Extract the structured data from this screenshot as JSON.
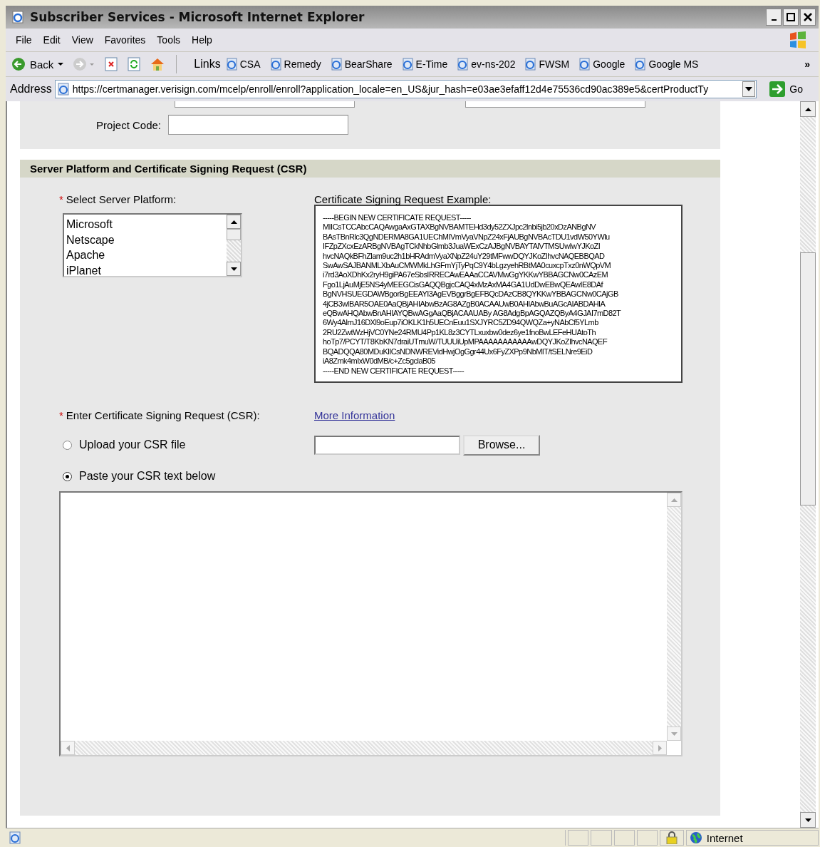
{
  "window": {
    "title": "Subscriber Services - Microsoft Internet Explorer"
  },
  "menu": [
    "File",
    "Edit",
    "View",
    "Favorites",
    "Tools",
    "Help"
  ],
  "toolbar": {
    "back": "Back",
    "links_label": "Links",
    "links": [
      "CSA",
      "Remedy",
      "BearShare",
      "E-Time",
      "ev-ns-202",
      "FWSM",
      "Google",
      "Google MS"
    ],
    "more": "»"
  },
  "address_bar": {
    "label": "Address",
    "url": "https://certmanager.verisign.com/mcelp/enroll/enroll?application_locale=en_US&jur_hash=e03ae3efaff12d4e75536cd90ac389e5&certProductTy",
    "go": "Go"
  },
  "form": {
    "project_code_label": "Project Code:",
    "section_title": "Server Platform and Certificate Signing Request (CSR)",
    "platform_label": "Select Server Platform:",
    "required_mark": "*",
    "platforms": [
      {
        "label": "Microsoft",
        "selected": false
      },
      {
        "label": "Netscape",
        "selected": false
      },
      {
        "label": "Apache",
        "selected": false
      },
      {
        "label": "iPlanet",
        "selected": false
      }
    ],
    "example_label": "Certificate Signing Request Example:",
    "example_lines": [
      "-----BEGIN NEW CERTIFICATE REQUEST-----",
      "MIICsTCCAbcCAQAwgaAxGTAXBgNVBAMTEHd3dy52ZXJpc2lnbi5jb20xDzANBgNV",
      "BAsTBnRlc3QgNDERMA8GA1UEChMIVmVyaVNpZ24xFjAUBgNVBAcTDU1vdW50YWlu",
      "IFZpZXcxEzARBgNVBAgTCkNhbGlmb3JuaWExCzAJBgNVBAYTAlVTMSUwIwYJKoZI",
      "hvcNAQkBFhZlam9uc2h1bHRAdmVyaXNpZ24uY29tMFwwDQYJKoZIhvcNAQEBBQAD",
      "SwAwSAJBANMLXbAuCMWMkLhGFmYjTyPqC9Y4bLgzyehRBtMA0cuxcpTxz0nWQpVM",
      "i7rd3AoXDhKx2ryH9giPA67eSbsIRRECAwEAAaCCAVMwGgYKKwYBBAGCNw0CAzEM",
      "Fgo1LjAuMjE5NS4yMEEGCisGAQQBgjcCAQ4xMzAxMA4GA1UdDwEBwQEAwIE8DAf",
      "BgNVHSUEGDAWBgorBgEEAYI3AgEVBggrBgEFBQcDAzCB8QYKKwYBBAGCNw0CAjGB",
      "4jCB3wIBAR5OAE0AaQBjAHIAbwBzAG8AZgB0ACAAUwB0AHIAbwBuAGcAIABDAHIA",
      "eQBwAHQAbwBnAHIAYQBwAGgAaQBjACAAUABy AG8AdgBpAGQAZQByA4GJAI7mD82T",
      "6Wy4AlmJ16DXl9oEup7iOKLK1h5UECnEuu1SXJYRC5ZD94QWQZa+yNAbCf5YLmb",
      "2RU2ZwtWzHjVC0YNe24RMU4Pp1KL8z3CYTLxuxbw0dez6ye1fnoBwLEFeHUAtoTh",
      "hoTp7/PCYT/T8KbKN7draiUTmuW/TUUUiUpMPAAAAAAAAAAAwDQYJKoZIhvcNAQEF",
      "BQADQQA80MDuKlICsNDNWREVidHwjOgGgr44Ux6FyZXPp9NbMIT/tSELNre9EiD",
      "iA8Zmk4mIxW0dMB/c+Zc5gclaB05",
      "-----END NEW CERTIFICATE REQUEST-----"
    ],
    "enter_label": "Enter Certificate Signing Request (CSR):",
    "more_info_link": "More Information",
    "csr_options": [
      {
        "label": "Upload your CSR file",
        "selected": false
      },
      {
        "label": "Paste your CSR text below",
        "selected": true
      }
    ],
    "browse_button": "Browse..."
  },
  "status_bar": {
    "zone": "Internet"
  }
}
